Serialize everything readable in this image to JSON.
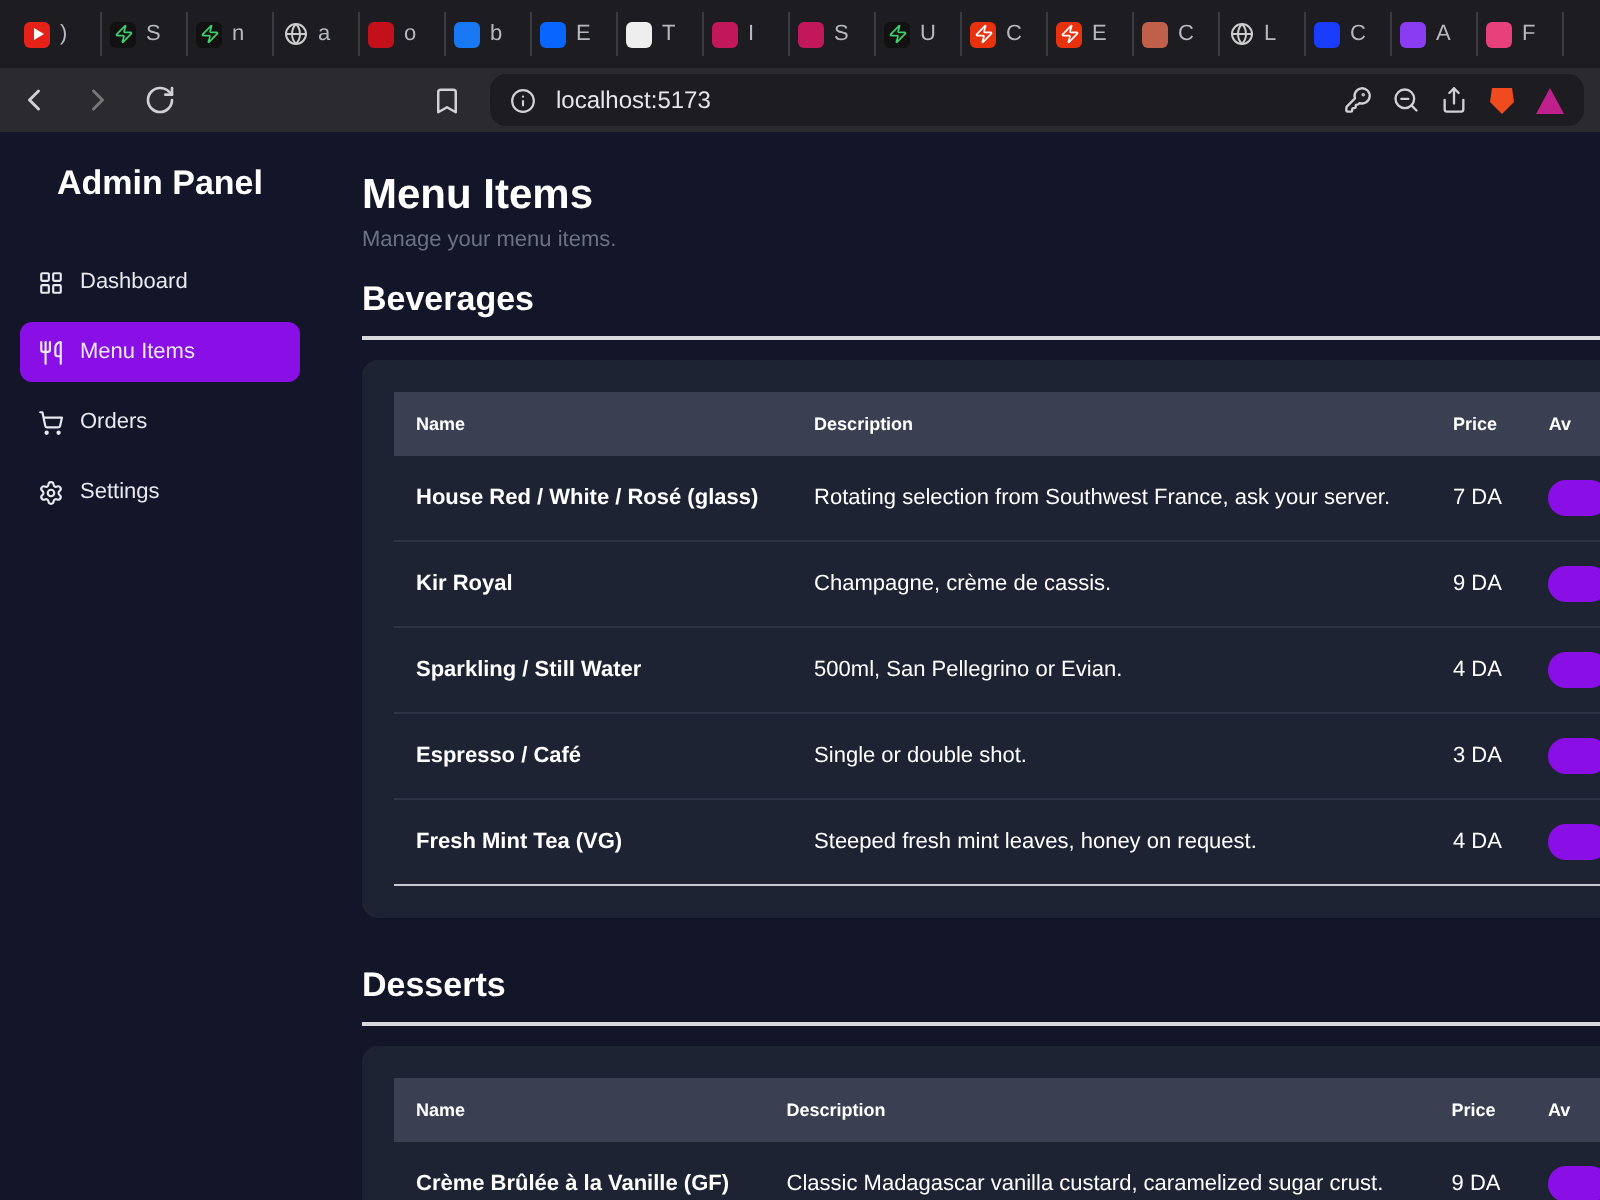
{
  "browser": {
    "tabs": [
      {
        "label": ")"
      },
      {
        "label": "S"
      },
      {
        "label": "n"
      },
      {
        "label": "a"
      },
      {
        "label": "o"
      },
      {
        "label": "b"
      },
      {
        "label": "E"
      },
      {
        "label": "T"
      },
      {
        "label": "I"
      },
      {
        "label": "S"
      },
      {
        "label": "U"
      },
      {
        "label": "C"
      },
      {
        "label": "E"
      },
      {
        "label": "C"
      },
      {
        "label": "L"
      },
      {
        "label": "C"
      },
      {
        "label": "A"
      },
      {
        "label": "F"
      }
    ],
    "address": "localhost:5173"
  },
  "sidebar": {
    "title": "Admin Panel",
    "items": [
      {
        "label": "Dashboard",
        "kind": "grid",
        "selected": false
      },
      {
        "label": "Menu Items",
        "kind": "utensils",
        "selected": true
      },
      {
        "label": "Orders",
        "kind": "cart",
        "selected": false
      },
      {
        "label": "Settings",
        "kind": "gear",
        "selected": false
      }
    ]
  },
  "page": {
    "title": "Menu Items",
    "subtitle": "Manage your menu items."
  },
  "sections": [
    {
      "title": "Beverages",
      "columns": [
        "Name",
        "Description",
        "Price",
        "Av"
      ],
      "rows": [
        {
          "name": "House Red / White / Rosé (glass)",
          "description": "Rotating selection from Southwest France, ask your server.",
          "price": "7 DA",
          "available": true
        },
        {
          "name": "Kir Royal",
          "description": "Champagne, crème de cassis.",
          "price": "9 DA",
          "available": true
        },
        {
          "name": "Sparkling / Still Water",
          "description": "500ml, San Pellegrino or Evian.",
          "price": "4 DA",
          "available": true
        },
        {
          "name": "Espresso / Café",
          "description": "Single or double shot.",
          "price": "3 DA",
          "available": true
        },
        {
          "name": "Fresh Mint Tea (VG)",
          "description": "Steeped fresh mint leaves, honey on request.",
          "price": "4 DA",
          "available": true
        }
      ]
    },
    {
      "title": "Desserts",
      "columns": [
        "Name",
        "Description",
        "Price",
        "Av"
      ],
      "rows": [
        {
          "name": "Crème Brûlée à la Vanille (GF)",
          "description": "Classic Madagascar vanilla custard, caramelized sugar crust.",
          "price": "9 DA",
          "available": true
        }
      ]
    }
  ]
}
